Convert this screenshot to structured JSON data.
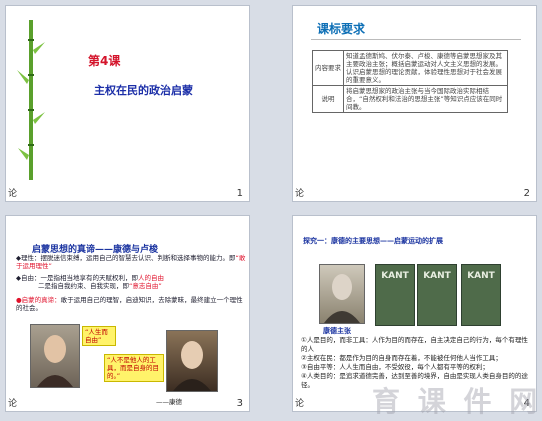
{
  "slide1": {
    "lesson": "第4课",
    "title": "主权在民的政治启蒙",
    "footer": "论",
    "number": "1"
  },
  "slide2": {
    "title": "课标要求",
    "rows": [
      {
        "key": "内容要求",
        "text": "知道孟德斯鸠、伏尔泰、卢梭、康德等启蒙思想家及其主要政治主张；概括启蒙运动对人文主义思想的发展。认识启蒙思想的理论贡献，体验理性思想对于社会发展的重要意义。"
      },
      {
        "key": "说明",
        "text": "将启蒙思想家的政治主张与当今国际政治实际相结合，“自然权利和法治的思想主张”等知识点应该在同时间教。"
      }
    ],
    "footer": "论",
    "number": "2"
  },
  "slide3": {
    "title": "启蒙思想的真谛——康德与卢梭",
    "p1": "◆理性：摆脱迷信束缚，运用自己的智慧去认识、判断和选择事物的能力。即",
    "p1_red": "“敢于运用理性”",
    "p2": "◆自由：一是指相当地享有的天赋权利，即",
    "p2_red": "人的自由",
    "p3": "二是指自我约束、自我实现，即",
    "p3_red": "“意志自由”",
    "p4a": "●启蒙的真谛：",
    "p4b": "敢于运用自己的理智，启迪知识，去除蒙昧，最终建立一个理性的社会。",
    "note1": "“人生而自由”",
    "note2": "“人不是他人的工具，而是自身的目的。”",
    "caption": "——康德",
    "footer": "论",
    "number": "3"
  },
  "slide4": {
    "title": "探究一：康德的主要思想——启蒙运动的扩展",
    "books": [
      "KANT",
      "KANT",
      "KANT"
    ],
    "sub": "康德主张",
    "items": [
      "①人是目的，而非工具：人作为目的而存在，自主决定自己的行为，每个有理性的人",
      "②主权在民：都是作为目的自身而存在着，不能被任何他人当作工具；",
      "③自由平等：人人生而自由，不受奴役，每个人都有平等的权利；",
      "④人类目的：是追求道德完善，达到至善的境界，自由是实现人类自身目的的途径。"
    ],
    "footer": "论",
    "number": "4"
  },
  "watermark": "育 课 件 网"
}
